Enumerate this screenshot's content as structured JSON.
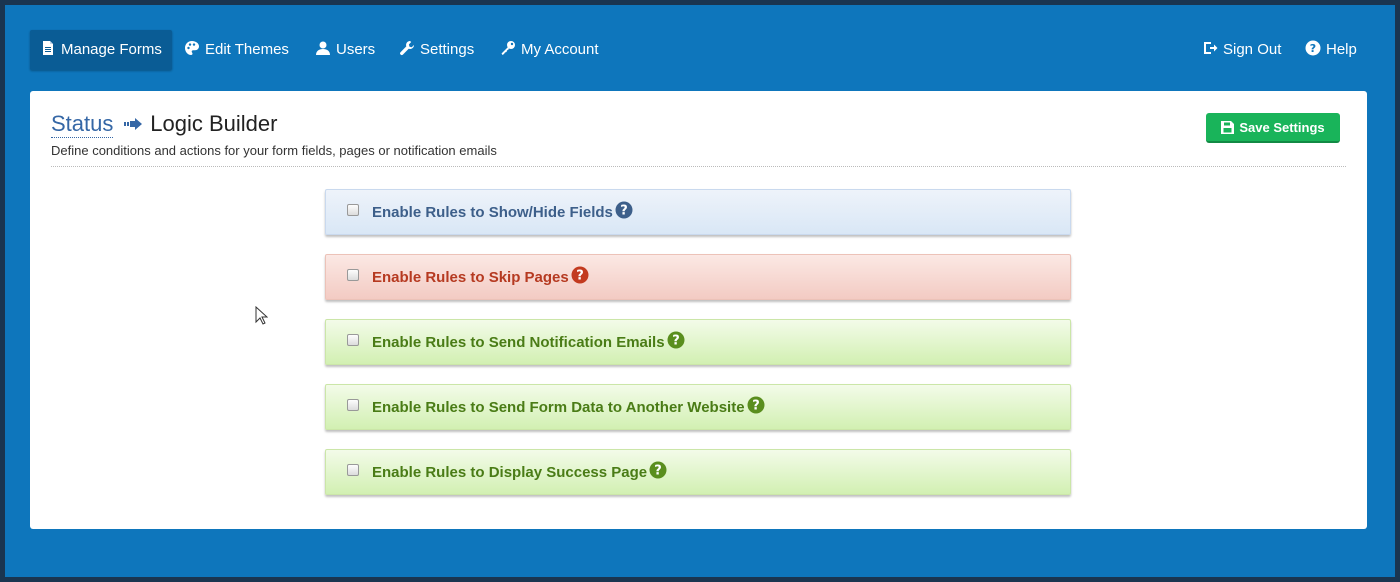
{
  "nav": {
    "items": [
      {
        "label": "Manage Forms",
        "icon": "document-icon"
      },
      {
        "label": "Edit Themes",
        "icon": "palette-icon"
      },
      {
        "label": "Users",
        "icon": "user-icon"
      },
      {
        "label": "Settings",
        "icon": "wrench-icon"
      },
      {
        "label": "My Account",
        "icon": "key-icon"
      }
    ],
    "right_items": [
      {
        "label": "Sign Out",
        "icon": "sign-out-icon"
      },
      {
        "label": "Help",
        "icon": "question-circle-icon"
      }
    ],
    "active": "Manage Forms"
  },
  "header": {
    "breadcrumb": "Status",
    "title": "Logic Builder",
    "subtitle": "Define conditions and actions for your form fields, pages or notification emails",
    "save_label": "Save Settings"
  },
  "rules": [
    {
      "label": "Enable Rules to Show/Hide Fields",
      "color": "#3d5f8a",
      "checked": false
    },
    {
      "label": "Enable Rules to Skip Pages",
      "color": "#b63a21",
      "checked": false
    },
    {
      "label": "Enable Rules to Send Notification Emails",
      "color": "#4a7c16",
      "checked": false
    },
    {
      "label": "Enable Rules to Send Form Data to Another Website",
      "color": "#4a7c16",
      "checked": false
    },
    {
      "label": "Enable Rules to Display Success Page",
      "color": "#4a7c16",
      "checked": false
    }
  ],
  "colors": {
    "background": "#0e76bc",
    "nav_active": "#0a5c95",
    "save_button": "#19b45a",
    "link": "#3567a6"
  }
}
